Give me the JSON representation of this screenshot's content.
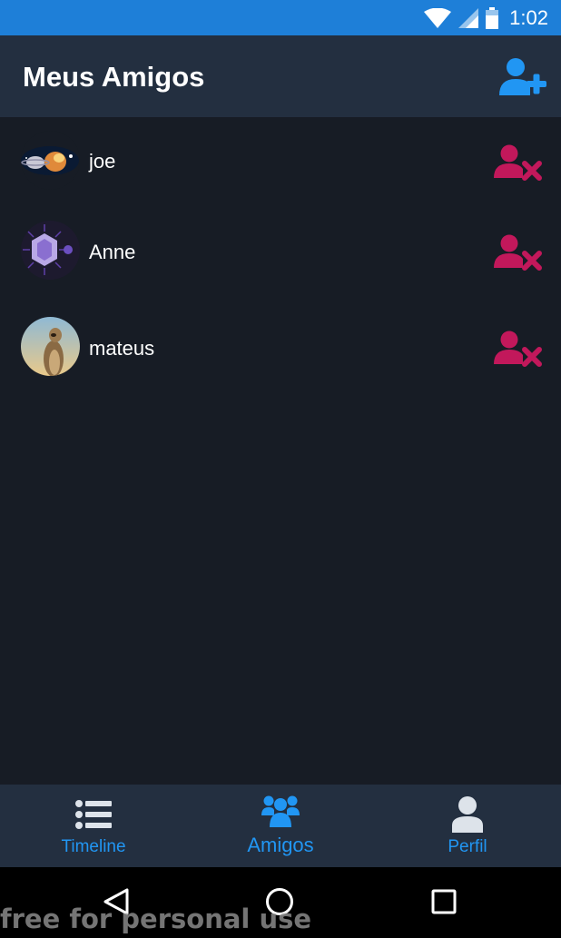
{
  "status_bar": {
    "time": "1:02",
    "icons": [
      "wifi-icon",
      "signal-icon",
      "battery-icon"
    ]
  },
  "app_bar": {
    "title": "Meus Amigos",
    "add_friend_icon": "add-user-icon"
  },
  "friends": [
    {
      "name": "joe",
      "avatar": "space-planet-image",
      "remove_icon": "remove-user-icon"
    },
    {
      "name": "Anne",
      "avatar": "purple-virus-image",
      "remove_icon": "remove-user-icon"
    },
    {
      "name": "mateus",
      "avatar": "meerkat-photo",
      "remove_icon": "remove-user-icon"
    }
  ],
  "bottom_nav": {
    "tabs": [
      {
        "label": "Timeline",
        "icon": "list-icon",
        "active": false
      },
      {
        "label": "Amigos",
        "icon": "users-group-icon",
        "active": true
      },
      {
        "label": "Perfil",
        "icon": "user-icon",
        "active": false
      }
    ]
  },
  "system_nav": {
    "buttons": [
      "back-icon",
      "home-icon",
      "recents-icon"
    ]
  },
  "watermark": "free for personal use",
  "colors": {
    "status_bar": "#1e7fd8",
    "app_bar": "#232f40",
    "background": "#171c25",
    "accent": "#2196f3",
    "remove": "#c2185b",
    "inactive_icon": "#dde3ea"
  }
}
